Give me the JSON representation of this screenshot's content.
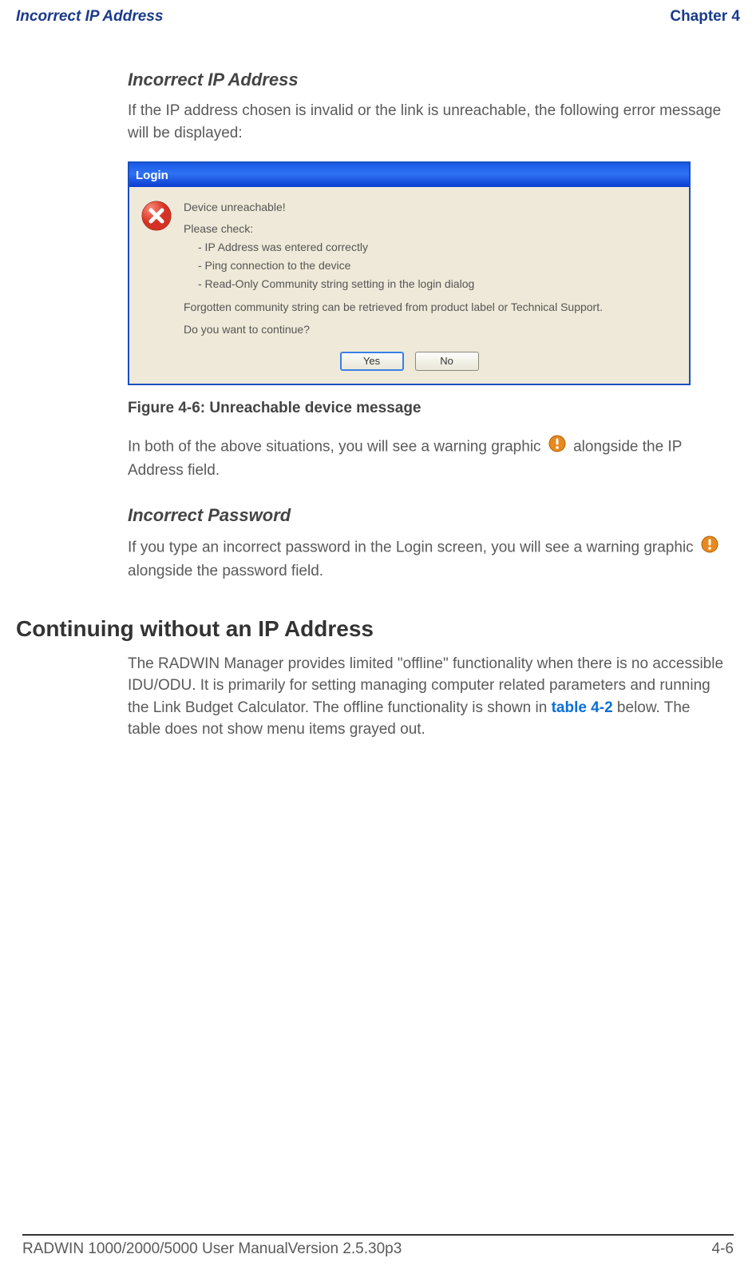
{
  "header": {
    "left": "Incorrect IP Address",
    "right": "Chapter 4"
  },
  "sec_ip": {
    "heading": "Incorrect IP Address",
    "para1": "If the IP address chosen is invalid or the link is unreachable, the following error message will be displayed:"
  },
  "dialog": {
    "title": "Login",
    "l1": "Device unreachable!",
    "l2": "Please check:",
    "l3": "- IP Address was entered correctly",
    "l4": "- Ping connection to the device",
    "l5": "- Read-Only Community string setting in the login dialog",
    "l6": "Forgotten community string can be retrieved from product label or Technical Support.",
    "l7": "Do you want to continue?",
    "yes": "Yes",
    "no": "No"
  },
  "figcap": "Figure 4-6: Unreachable device message",
  "after_fig": {
    "t1": "In both of the above situations, you will see a warning graphic ",
    "t2": " alongside the IP Address field."
  },
  "sec_pw": {
    "heading": "Incorrect Password",
    "t1": "If you type an incorrect password in the Login screen, you will see a warning graphic ",
    "t2": " alongside the password field."
  },
  "sec_cont": {
    "heading": "Continuing without an IP Address",
    "t1": "The RADWIN Manager provides limited \"offline\" functionality when there is no accessible IDU/ODU. It is primarily for setting managing computer related parameters and running the Link Budget Calculator. The offline functionality is shown in ",
    "link": "table 4-2",
    "t2": " below. The table does not show menu items grayed out."
  },
  "footer": {
    "left": "RADWIN 1000/2000/5000 User ManualVersion  2.5.30p3",
    "right": "4-6"
  }
}
